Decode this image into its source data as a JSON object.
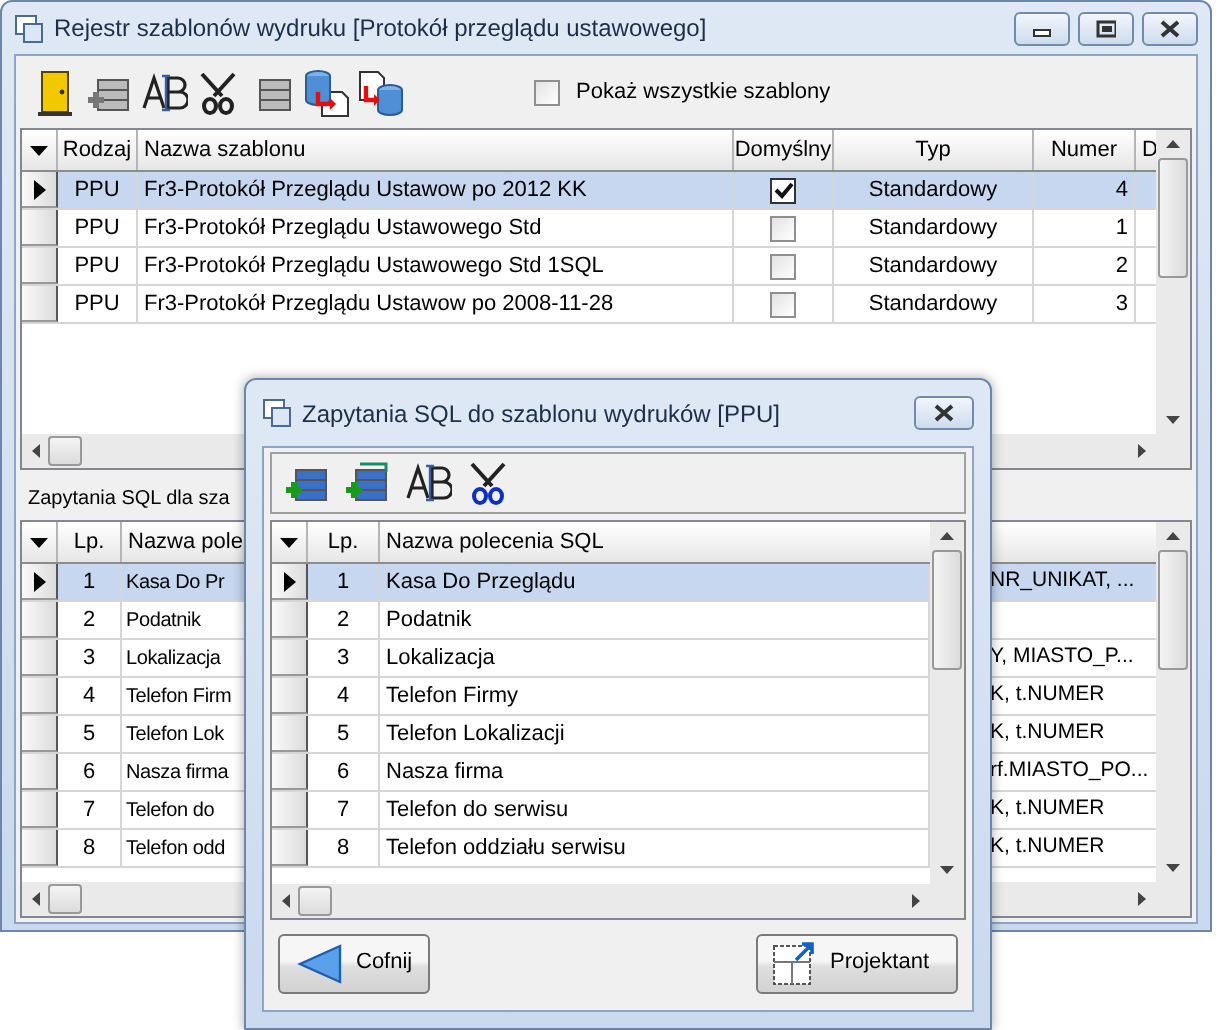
{
  "main_window": {
    "title": "Rejestr szablonów wydruku [Protokół przeglądu ustawowego]",
    "show_all_checkbox": {
      "label": "Pokaż wszystkie szablony",
      "checked": false
    },
    "templates_table": {
      "columns": [
        "Rodzaj",
        "Nazwa szablonu",
        "Domyślny",
        "Typ",
        "Numer",
        "D"
      ],
      "rows": [
        {
          "rodzaj": "PPU",
          "nazwa": "Fr3-Protokół Przeglądu Ustawow po 2012 KK",
          "default": true,
          "typ": "Standardowy",
          "numer": "4",
          "selected": true
        },
        {
          "rodzaj": "PPU",
          "nazwa": "Fr3-Protokół Przeglądu Ustawowego Std",
          "default": false,
          "typ": "Standardowy",
          "numer": "1",
          "selected": false
        },
        {
          "rodzaj": "PPU",
          "nazwa": "Fr3-Protokół Przeglądu Ustawowego Std 1SQL",
          "default": false,
          "typ": "Standardowy",
          "numer": "2",
          "selected": false
        },
        {
          "rodzaj": "PPU",
          "nazwa": "Fr3-Protokół Przeglądu Ustawow po 2008-11-28",
          "default": false,
          "typ": "Standardowy",
          "numer": "3",
          "selected": false
        }
      ]
    },
    "queries_label": "Zapytania SQL dla sza",
    "queries_table": {
      "columns": [
        "Lp.",
        "Nazwa pole"
      ],
      "rows": [
        {
          "lp": "1",
          "name": "Kasa Do Pr",
          "column_3": "NR_UNIKAT, ...",
          "selected": true
        },
        {
          "lp": "2",
          "name": "Podatnik",
          "selected": false
        },
        {
          "lp": "3",
          "name": "Lokalizacja",
          "column_3": "Y, MIASTO_P...",
          "selected": false
        },
        {
          "lp": "4",
          "name": "Telefon Firm",
          "column_3": "K, t.NUMER",
          "selected": false
        },
        {
          "lp": "5",
          "name": "Telefon Lok",
          "column_3": "K, t.NUMER",
          "selected": false
        },
        {
          "lp": "6",
          "name": "Nasza firma",
          "column_3": "rf.MIASTO_PO...",
          "selected": false
        },
        {
          "lp": "7",
          "name": "Telefon do",
          "column_3": "K, t.NUMER",
          "selected": false
        },
        {
          "lp": "8",
          "name": "Telefon odd",
          "column_3": "K, t.NUMER",
          "selected": false
        }
      ]
    }
  },
  "dialog": {
    "title": "Zapytania SQL do szablonu wydruków [PPU]",
    "table": {
      "columns": [
        "Lp.",
        "Nazwa polecenia SQL"
      ],
      "rows": [
        {
          "lp": "1",
          "name": "Kasa Do Przeglądu",
          "selected": true
        },
        {
          "lp": "2",
          "name": "Podatnik",
          "selected": false
        },
        {
          "lp": "3",
          "name": "Lokalizacja",
          "selected": false
        },
        {
          "lp": "4",
          "name": "Telefon Firmy",
          "selected": false
        },
        {
          "lp": "5",
          "name": "Telefon Lokalizacji",
          "selected": false
        },
        {
          "lp": "6",
          "name": "Nasza firma",
          "selected": false
        },
        {
          "lp": "7",
          "name": "Telefon do serwisu",
          "selected": false
        },
        {
          "lp": "8",
          "name": "Telefon oddziału serwisu",
          "selected": false
        }
      ]
    },
    "buttons": [
      {
        "label": "Cofnij",
        "kind": "back"
      },
      {
        "label": "Projektant",
        "kind": "designer"
      }
    ]
  }
}
